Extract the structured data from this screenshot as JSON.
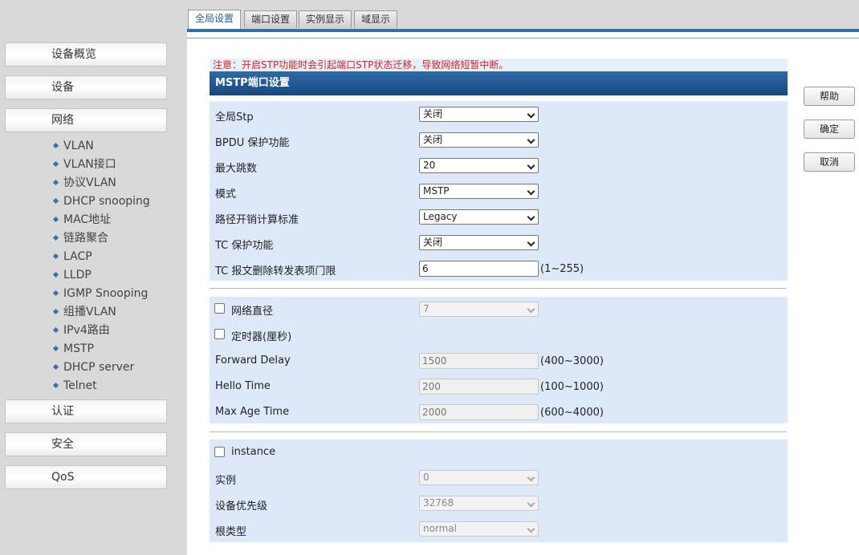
{
  "sidebar": {
    "top_items": [
      "设备概览",
      "设备",
      "网络"
    ],
    "sub_items": [
      "VLAN",
      "VLAN接口",
      "协议VLAN",
      "DHCP snooping",
      "MAC地址",
      "链路聚合",
      "LACP",
      "LLDP",
      "IGMP Snooping",
      "组播VLAN",
      "IPv4路由",
      "MSTP",
      "DHCP server",
      "Telnet"
    ],
    "bottom_items": [
      "认证",
      "安全",
      "QoS"
    ]
  },
  "tabs": [
    "全局设置",
    "端口设置",
    "实例显示",
    "域显示"
  ],
  "active_tab": "全局设置",
  "notice": "注意：开启STP功能时会引起端口STP状态迁移，导致网络短暂中断。",
  "section_title": "MSTP端口设置",
  "global": {
    "stp": {
      "label": "全局Stp",
      "value": "关闭"
    },
    "bpdu": {
      "label": "BPDU 保护功能",
      "value": "关闭"
    },
    "max_hops": {
      "label": "最大跳数",
      "value": "20"
    },
    "mode": {
      "label": "模式",
      "value": "MSTP"
    },
    "path_cost": {
      "label": "路径开销计算标准",
      "value": "Legacy"
    },
    "tc_protect": {
      "label": "TC 保护功能",
      "value": "关闭"
    },
    "tc_threshold": {
      "label": "TC 报文删除转发表项门限",
      "value": "6",
      "range": "(1~255)"
    }
  },
  "network": {
    "diameter": {
      "label": "网络直径",
      "value": "7"
    },
    "timer": {
      "label": "定时器(厘秒)"
    },
    "forward_delay": {
      "label": "Forward Delay",
      "value": "1500",
      "range": "(400~3000)"
    },
    "hello_time": {
      "label": "Hello Time",
      "value": "200",
      "range": "(100~1000)"
    },
    "max_age": {
      "label": "Max Age Time",
      "value": "2000",
      "range": "(600~4000)"
    }
  },
  "instance": {
    "checkbox": {
      "label": "instance"
    },
    "instance_id": {
      "label": "实例",
      "value": "0"
    },
    "priority": {
      "label": "设备优先级",
      "value": "32768"
    },
    "root_type": {
      "label": "根类型",
      "value": "normal"
    }
  },
  "buttons": {
    "help": "帮助",
    "ok": "确定",
    "cancel": "取消"
  }
}
